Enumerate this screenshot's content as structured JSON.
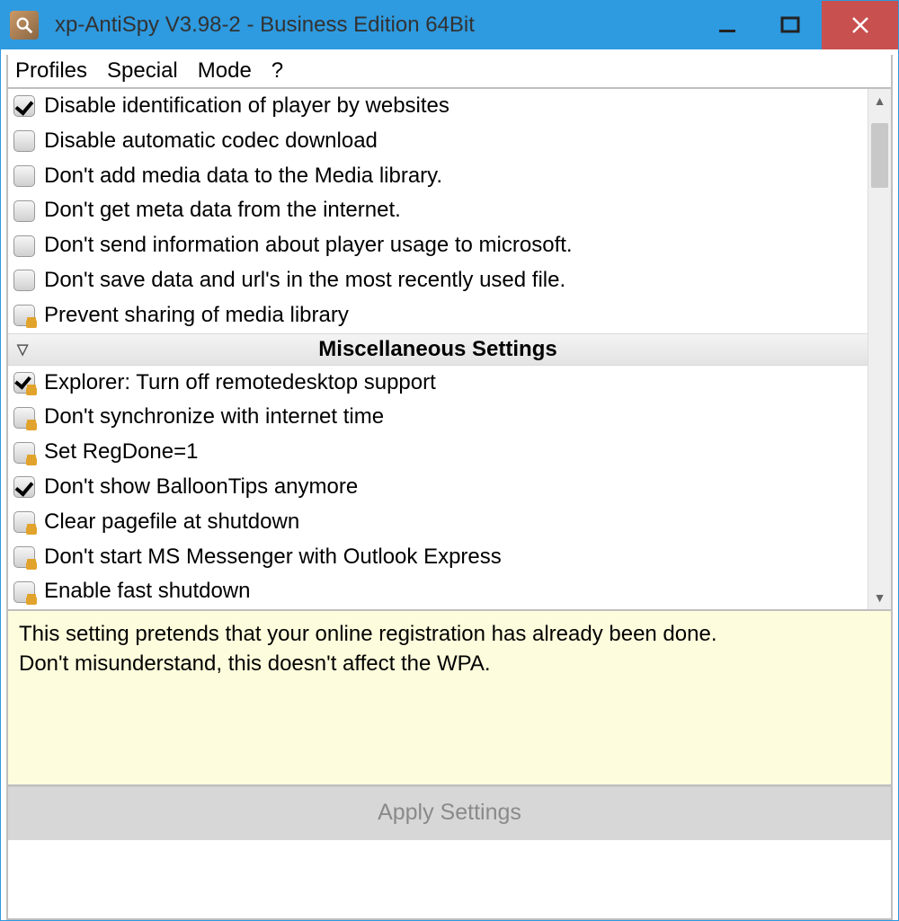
{
  "window": {
    "title": "xp-AntiSpy V3.98-2 -  Business Edition 64Bit"
  },
  "menubar": {
    "items": [
      "Profiles",
      "Special",
      "Mode",
      "?"
    ]
  },
  "list": {
    "items_top": [
      {
        "state": "checked",
        "label": "Disable identification of player by websites"
      },
      {
        "state": "plain",
        "label": "Disable automatic codec download"
      },
      {
        "state": "plain",
        "label": "Don't add media data to the Media library."
      },
      {
        "state": "plain",
        "label": "Don't get meta data from the internet."
      },
      {
        "state": "plain",
        "label": "Don't send information about player usage to microsoft."
      },
      {
        "state": "plain",
        "label": "Don't save data and url's in the most recently used file."
      },
      {
        "state": "locked",
        "label": "Prevent sharing of media library"
      }
    ],
    "section": "Miscellaneous Settings",
    "items_bottom": [
      {
        "state": "lockchecked",
        "label": "Explorer: Turn off remotedesktop support"
      },
      {
        "state": "locked",
        "label": "Don't synchronize with internet time"
      },
      {
        "state": "locked",
        "label": "Set RegDone=1"
      },
      {
        "state": "checked",
        "label": "Don't show BalloonTips anymore"
      },
      {
        "state": "locked",
        "label": "Clear pagefile at shutdown"
      },
      {
        "state": "locked",
        "label": "Don't start MS Messenger with Outlook Express"
      },
      {
        "state": "locked",
        "label": "Enable fast shutdown"
      }
    ]
  },
  "info": {
    "line1": "This setting pretends that your online registration has already been done.",
    "line2": "Don't misunderstand, this doesn't affect the WPA."
  },
  "apply_label": "Apply Settings"
}
